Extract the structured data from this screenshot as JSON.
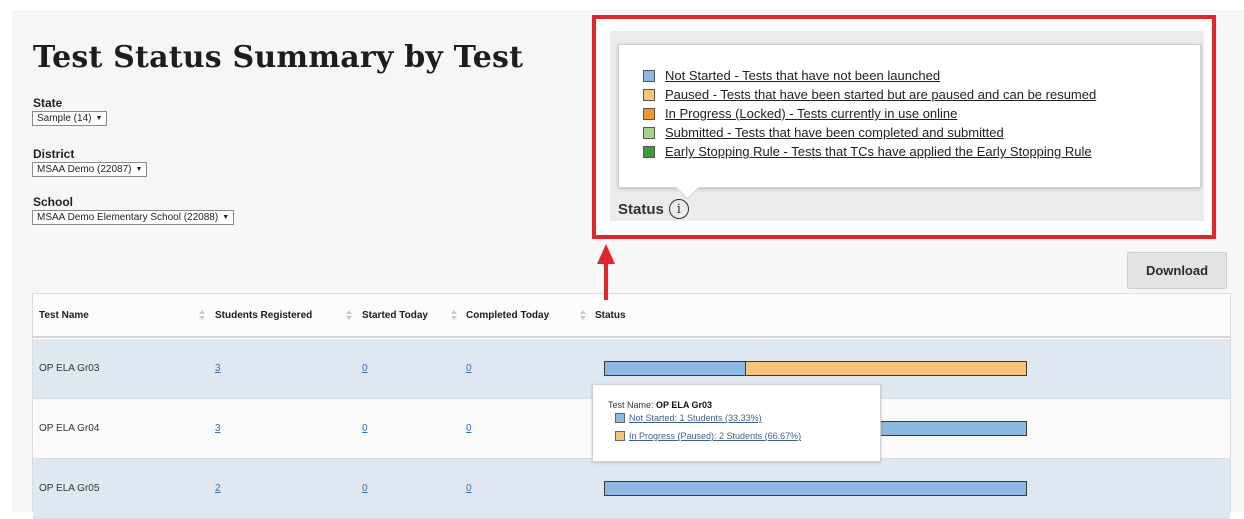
{
  "page": {
    "title": "Test Status Summary by Test"
  },
  "filters": {
    "state": {
      "label": "State",
      "value": "Sample (14)"
    },
    "district": {
      "label": "District",
      "value": "MSAA Demo (22087)"
    },
    "school": {
      "label": "School",
      "value": "MSAA Demo Elementary School (22088)"
    }
  },
  "toolbar": {
    "download_label": "Download"
  },
  "legend": {
    "items": [
      {
        "label": "Not Started - Tests that have not been launched",
        "color": "#8db8e2"
      },
      {
        "label": "Paused - Tests that have been started but are paused and can be resumed",
        "color": "#f7c47a"
      },
      {
        "label": "In Progress (Locked) - Tests currently in use online",
        "color": "#f0962e"
      },
      {
        "label": "Submitted - Tests that have been completed and submitted",
        "color": "#a6d38a"
      },
      {
        "label": "Early Stopping Rule - Tests that TCs have applied the Early Stopping Rule",
        "color": "#3f9a3a"
      }
    ],
    "status_heading": "Status",
    "info_icon": "i"
  },
  "table": {
    "columns": [
      "Test Name",
      "Students Registered",
      "Started Today",
      "Completed Today",
      "Status"
    ],
    "rows": [
      {
        "test_name": "OP ELA Gr03",
        "registered": "3",
        "started_today": "0",
        "completed_today": "0",
        "status_segments": [
          {
            "fraction": 0.3333,
            "color": "#8db8e2"
          },
          {
            "fraction": 0.6667,
            "color": "#f7c47a"
          }
        ]
      },
      {
        "test_name": "OP ELA Gr04",
        "registered": "3",
        "started_today": "0",
        "completed_today": "0",
        "status_segments": [
          {
            "fraction": 1.0,
            "color": "#8db8e2"
          }
        ]
      },
      {
        "test_name": "OP ELA Gr05",
        "registered": "2",
        "started_today": "0",
        "completed_today": "0",
        "status_segments": [
          {
            "fraction": 1.0,
            "color": "#8db8e2"
          }
        ]
      }
    ]
  },
  "row_tooltip": {
    "prefix": "Test Name: ",
    "test_name": "OP ELA Gr03",
    "items": [
      {
        "label": "Not Started: 1 Students (33.33%)",
        "color": "#8db8e2"
      },
      {
        "label": "In Progress (Paused): 2 Students (66.67%)",
        "color": "#f7c47a"
      }
    ]
  },
  "annotation": {
    "color": "#e0262d"
  }
}
